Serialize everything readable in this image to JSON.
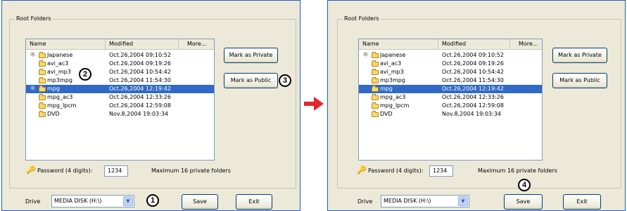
{
  "group_title": "Root Folders",
  "columns": {
    "name": "Name",
    "modified": "Modified",
    "more": "More..."
  },
  "rows": [
    {
      "name": "Japanese",
      "modified": "Oct.26,2004 09:10:52"
    },
    {
      "name": "avi_ac3",
      "modified": "Oct.26,2004 09:19:26"
    },
    {
      "name": "avi_mp3",
      "modified": "Oct.26,2004 10:54:42"
    },
    {
      "name": "mp3mpg",
      "modified": "Oct.26,2004 11:54:30"
    },
    {
      "name": "mpg",
      "modified": "Oct.26,2004 12:19:42"
    },
    {
      "name": "mpg_ac3",
      "modified": "Oct.26,2004 12:33:26"
    },
    {
      "name": "mpg_lpcm",
      "modified": "Oct.26,2004 12:59:08"
    },
    {
      "name": "DVD",
      "modified": "Nov.8,2004 19:03:34"
    }
  ],
  "buttons": {
    "mark_private": "Mark as Private",
    "mark_public": "Mark as Public",
    "save": "Save",
    "exit": "Exit"
  },
  "password": {
    "label": "Password (4 digits):",
    "value": "1234"
  },
  "max_note": "Maximum 16 private folders",
  "drive": {
    "label": "Drive",
    "value": "MEDIA DISK (H:\\)"
  },
  "callouts": {
    "c1": "1",
    "c2": "2",
    "c3": "3",
    "c4": "4"
  },
  "colors": {
    "selection": "#316ac5",
    "arrow": "#e8242c",
    "window_border": "#1d5fc7"
  }
}
